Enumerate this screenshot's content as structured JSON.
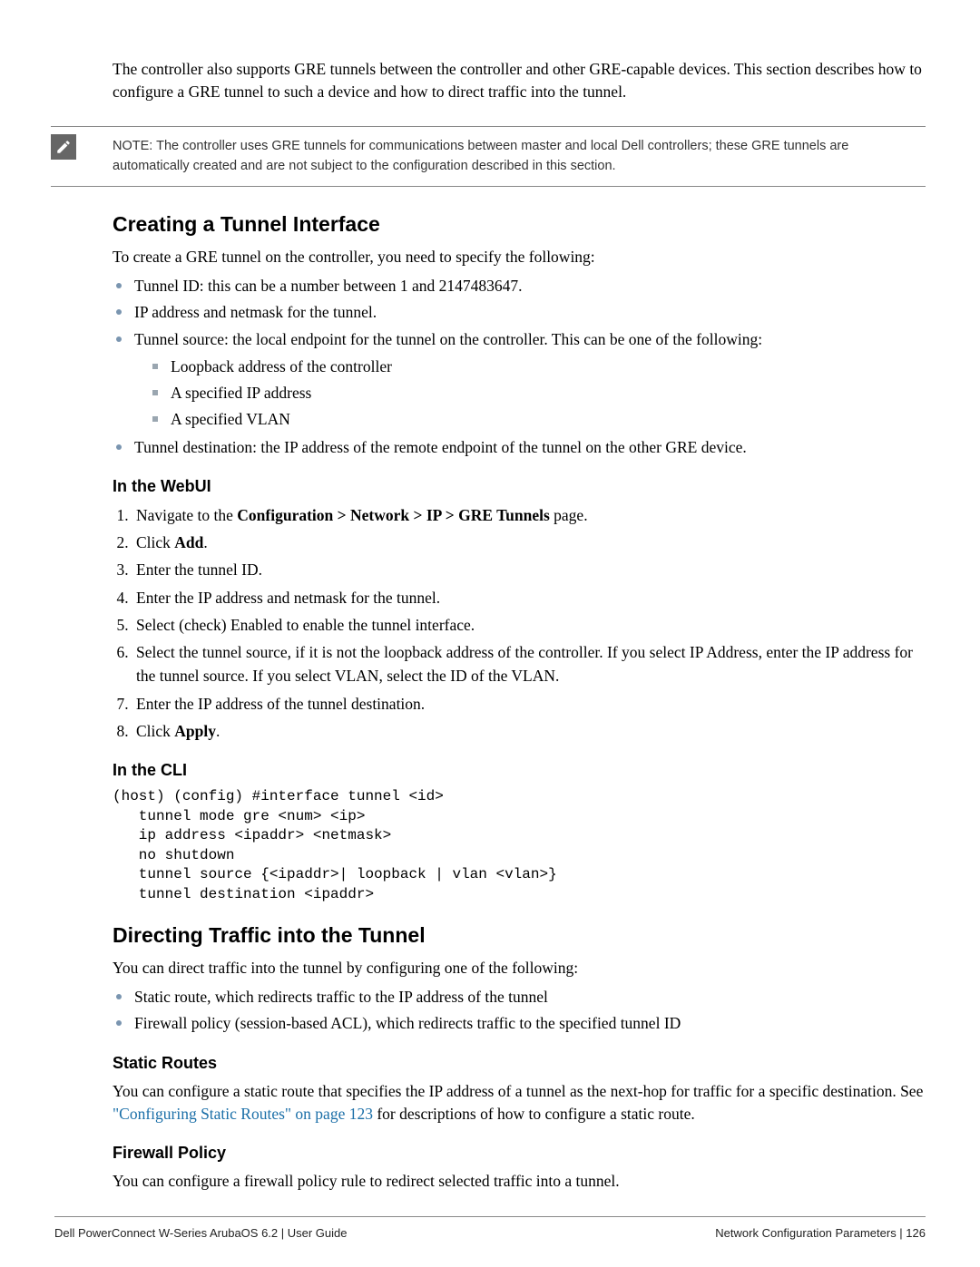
{
  "intro": "The controller also supports GRE tunnels between the controller and other GRE-capable devices. This section describes how to configure a GRE tunnel to such a device and how to direct traffic into the tunnel.",
  "note": {
    "label": "NOTE:",
    "text": "The controller uses GRE tunnels for communications between master and local Dell controllers; these GRE tunnels are automatically created and are not subject to the configuration described in this section."
  },
  "sec1": {
    "title": "Creating a Tunnel Interface",
    "intro": "To create a GRE tunnel on the controller, you need to specify the following:",
    "bullets": [
      "Tunnel ID: this can be a number between 1 and 2147483647.",
      "IP address and netmask for the tunnel.",
      "Tunnel source: the local endpoint for the tunnel on the controller. This can be one of the following:",
      "Tunnel destination: the IP address of the remote endpoint of the tunnel on the other GRE device."
    ],
    "sub_bullets": [
      "Loopback address of the controller",
      "A specified IP address",
      "A specified VLAN"
    ],
    "webui_title": "In the WebUI",
    "steps": {
      "s1_pre": "Navigate to the ",
      "s1_bold": "Configuration > Network > IP > GRE Tunnels",
      "s1_post": " page.",
      "s2_pre": "Click ",
      "s2_bold": "Add",
      "s2_post": ".",
      "s3": "Enter the tunnel ID.",
      "s4": "Enter the IP address and netmask for the tunnel.",
      "s5": "Select (check) Enabled to enable the tunnel interface.",
      "s6": "Select the tunnel source, if it is not the loopback address of the controller. If you select IP Address, enter the IP address for the tunnel source. If you select VLAN, select the ID of the VLAN.",
      "s7": "Enter the IP address of the tunnel destination.",
      "s8_pre": "Click ",
      "s8_bold": "Apply",
      "s8_post": "."
    },
    "cli_title": "In the CLI",
    "cli": "(host) (config) #interface tunnel <id>\n   tunnel mode gre <num> <ip>\n   ip address <ipaddr> <netmask>\n   no shutdown\n   tunnel source {<ipaddr>| loopback | vlan <vlan>}\n   tunnel destination <ipaddr>"
  },
  "sec2": {
    "title": "Directing Traffic into the Tunnel",
    "intro": "You can direct traffic into the tunnel by configuring one of the following:",
    "bullets": [
      "Static route, which redirects traffic to the IP address of the tunnel",
      "Firewall policy (session-based ACL), which redirects traffic to the specified tunnel ID"
    ],
    "static_title": "Static Routes",
    "static_pre": "You can configure a static route that specifies the IP address of a tunnel as the next-hop for traffic for a specific destination. See ",
    "static_link": "\"Configuring Static Routes\" on page 123",
    "static_post": " for descriptions of how to configure a static route.",
    "fw_title": "Firewall Policy",
    "fw_text": "You can configure a firewall policy rule to redirect selected traffic into a tunnel."
  },
  "footer": {
    "left": "Dell PowerConnect W-Series ArubaOS 6.2  |  User Guide",
    "right": "Network Configuration Parameters  |  126"
  }
}
